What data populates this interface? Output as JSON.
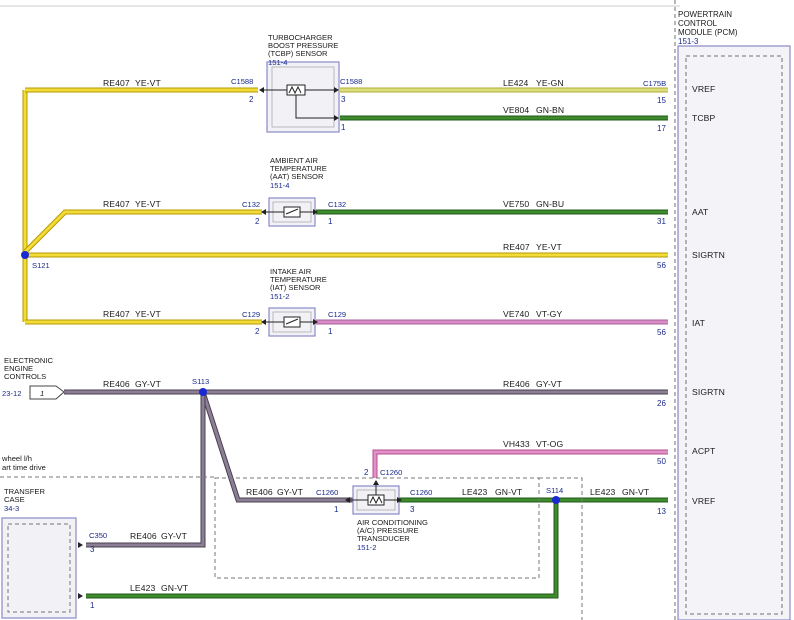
{
  "pcm": {
    "title": [
      "POWERTRAIN",
      "CONTROL",
      "MODULE (PCM)"
    ],
    "ref": "151-3",
    "pins": [
      {
        "num": "15",
        "name": "VREF"
      },
      {
        "num": "17",
        "name": "TCBP"
      },
      {
        "num": "31",
        "name": "AAT"
      },
      {
        "num": "56",
        "name": "SIGRTN"
      },
      {
        "num": "56",
        "name": "IAT"
      },
      {
        "num": "26",
        "name": "SIGRTN"
      },
      {
        "num": "50",
        "name": "ACPT"
      },
      {
        "num": "13",
        "name": "VREF"
      }
    ],
    "connector": "C175B"
  },
  "sensors": {
    "tcbp": {
      "title": [
        "TURBOCHARGER",
        "BOOST PRESSURE",
        "(TCBP) SENSOR"
      ],
      "ref": "151-4",
      "conn_left": "C1588",
      "conn_right": "C1588",
      "pin_left": "2",
      "pin_right_top": "3",
      "pin_right_bot": "1"
    },
    "aat": {
      "title": [
        "AMBIENT AIR",
        "TEMPERATURE",
        "(AAT) SENSOR"
      ],
      "ref": "151-4",
      "conn_left": "C132",
      "conn_right": "C132",
      "pin_left": "2",
      "pin_right": "1"
    },
    "iat": {
      "title": [
        "INTAKE AIR",
        "TEMPERATURE",
        "(IAT) SENSOR"
      ],
      "ref": "151-2",
      "conn_left": "C129",
      "conn_right": "C129",
      "pin_left": "2",
      "pin_right": "1"
    },
    "acpt": {
      "title": [
        "AIR CONDITIONING",
        "(A/C) PRESSURE",
        "TRANSDUCER"
      ],
      "ref": "151-2",
      "conn_left": "C1260",
      "conn_right": "C1260",
      "conn_top": "C1260",
      "pin_left": "1",
      "pin_right": "3",
      "pin_top": "2"
    }
  },
  "wires": {
    "w1": {
      "code": "RE407",
      "color": "YE-VT"
    },
    "w2": {
      "code": "LE424",
      "color": "YE-GN"
    },
    "w3": {
      "code": "VE804",
      "color": "GN-BN"
    },
    "w4": {
      "code": "RE407",
      "color": "YE-VT"
    },
    "w5": {
      "code": "VE750",
      "color": "GN-BU"
    },
    "w6": {
      "code": "RE407",
      "color": "YE-VT"
    },
    "w7": {
      "code": "RE407",
      "color": "YE-VT"
    },
    "w8": {
      "code": "VE740",
      "color": "VT-GY"
    },
    "w9": {
      "code": "RE406",
      "color": "GY-VT"
    },
    "w10": {
      "code": "RE406",
      "color": "GY-VT"
    },
    "w11": {
      "code": "VH433",
      "color": "VT-OG"
    },
    "w12": {
      "code": "RE406",
      "color": "GY-VT"
    },
    "w13": {
      "code": "LE423",
      "color": "GN-VT"
    },
    "w14": {
      "code": "LE423",
      "color": "GN-VT"
    },
    "w15": {
      "code": "RE406",
      "color": "GY-VT"
    },
    "w16": {
      "code": "LE423",
      "color": "GN-VT"
    }
  },
  "splices": {
    "s121": "S121",
    "s113": "S113",
    "s114": "S114"
  },
  "eec": {
    "title": [
      "ELECTRONIC",
      "ENGINE",
      "CONTROLS"
    ],
    "ref": "23-12",
    "pin": "1"
  },
  "transfer": {
    "title": [
      "TRANSFER",
      "CASE"
    ],
    "ref": "34-3",
    "conn": "C350",
    "pin_top": "3",
    "pin_bot": "1"
  },
  "note": {
    "line1": "wheel l/h",
    "line2": "art time drive"
  },
  "colors": {
    "yellow": "#f3dc3a",
    "green": "#3f8a2c",
    "pink": "#d98bc6",
    "gray": "#8c7f95",
    "blue": "#1a2a8a",
    "dash": "#6f6f6f"
  }
}
